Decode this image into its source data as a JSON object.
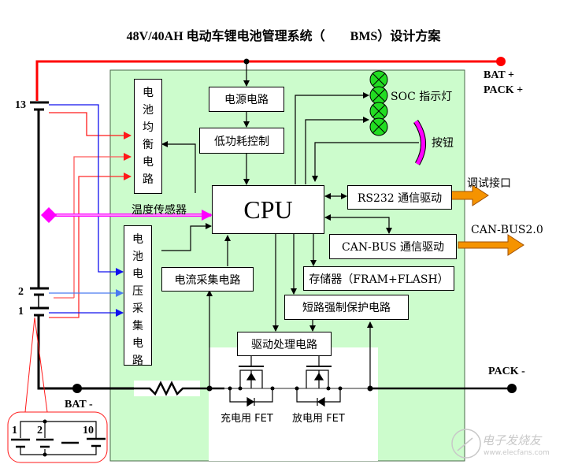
{
  "title": "48V/40AH 电动车锂电池管理系统（　　BMS）设计方案",
  "terminals": {
    "bat_plus": "BAT +",
    "pack_plus": "PACK +",
    "bat_minus": "BAT -",
    "pack_minus": "PACK -"
  },
  "cells": {
    "top": "13",
    "cell2": "2",
    "cell1": "1",
    "detail": [
      "1",
      "2",
      "10"
    ]
  },
  "blocks": {
    "power": "电源电路",
    "low_power": "低功耗控制",
    "cpu": "CPU",
    "rs232": "RS232 通信驱动",
    "canbus": "CAN-BUS 通信驱动",
    "current_sample": "电流采集电路",
    "memory": "存储器（FRAM+FLASH）",
    "short_protect": "短路强制保护电路",
    "driver": "驱动处理电路",
    "balance": [
      "电",
      "池",
      "均",
      "衡",
      "电",
      "路"
    ],
    "voltage_sample": [
      "电",
      "池",
      "电",
      "压",
      "采",
      "集",
      "电",
      "路"
    ]
  },
  "labels": {
    "temp_sensor": "温度传感器",
    "soc_led": "SOC 指示灯",
    "button": "按钮",
    "debug_port": "调试接口",
    "canbus_out": "CAN-BUS2.0",
    "charge_fet": "充电用 FET",
    "discharge_fet": "放电用 FET",
    "watermark_cn": "电子发烧友",
    "watermark_url": "www.elecfans.com"
  },
  "colors": {
    "board_bg": "#ccfccc",
    "bat_plus_line": "#ff0000",
    "balance_line": "#ff2020",
    "voltage_line": "#2020ff",
    "temp_line": "#ff00ff",
    "led_green": "#22dd22",
    "interface_arrow": "#f59300"
  }
}
